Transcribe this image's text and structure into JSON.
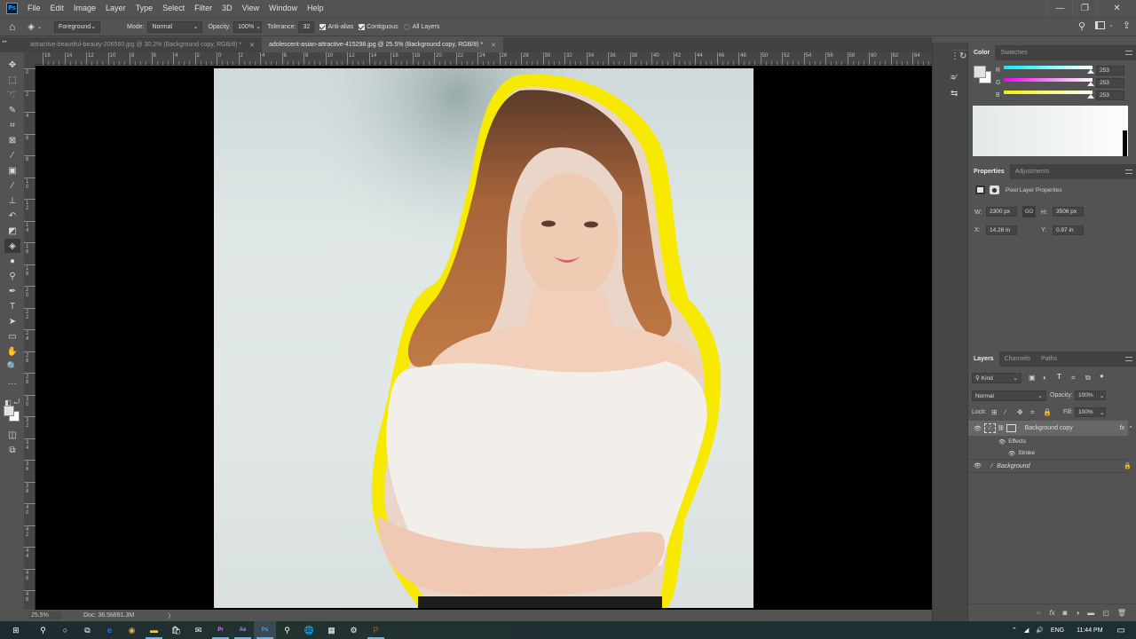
{
  "app": {
    "logo": "Ps",
    "accent": "#31a8ff"
  },
  "menubar": {
    "items": [
      "File",
      "Edit",
      "Image",
      "Layer",
      "Type",
      "Select",
      "Filter",
      "3D",
      "View",
      "Window",
      "Help"
    ]
  },
  "window_controls": {
    "minimize": "—",
    "restore": "❐",
    "close": "✕"
  },
  "options_bar": {
    "fill_source": "Foreground",
    "mode_label": "Mode:",
    "mode_value": "Normal",
    "opacity_label": "Opacity:",
    "opacity_value": "100%",
    "tolerance_label": "Tolerance:",
    "tolerance_value": "32",
    "anti_alias_label": "Anti-alias",
    "anti_alias_checked": true,
    "contiguous_label": "Contiguous",
    "contiguous_checked": true,
    "all_layers_label": "All Layers",
    "all_layers_checked": false
  },
  "doc_tabs": [
    {
      "title": "attractive-beautiful-beauty-206560.jpg @ 30.2% (Background copy, RGB/8) *",
      "active": false
    },
    {
      "title": "adolescent-asian-attractive-415298.jpg @ 25.5% (Background copy, RGB/8) *",
      "active": true
    }
  ],
  "ruler_top": {
    "labels": [
      "16",
      "14",
      "12",
      "10",
      "8",
      "6",
      "4",
      "2",
      "0",
      "2",
      "4",
      "6",
      "8",
      "10",
      "12",
      "14",
      "16",
      "18",
      "20",
      "22",
      "24",
      "26",
      "28",
      "30",
      "32",
      "34",
      "36",
      "38",
      "40",
      "42",
      "44",
      "46",
      "48",
      "50",
      "52",
      "54",
      "56",
      "58",
      "60",
      "62",
      "64"
    ]
  },
  "ruler_left": {
    "labels": [
      "0",
      "2",
      "4",
      "6",
      "8",
      "10",
      "12",
      "14",
      "16",
      "18",
      "20",
      "22",
      "24",
      "26",
      "28",
      "30",
      "32",
      "34",
      "36",
      "38",
      "40",
      "42",
      "44",
      "46",
      "48"
    ]
  },
  "tools": [
    {
      "name": "move-tool",
      "glyph": "✥"
    },
    {
      "name": "marquee-tool",
      "glyph": "⬚"
    },
    {
      "name": "lasso-tool",
      "glyph": "➰"
    },
    {
      "name": "quick-selection-tool",
      "glyph": "✎"
    },
    {
      "name": "crop-tool",
      "glyph": "⌗"
    },
    {
      "name": "frame-tool",
      "glyph": "⊠"
    },
    {
      "name": "eyedropper-tool",
      "glyph": "⁄"
    },
    {
      "name": "healing-brush-tool",
      "glyph": "▣"
    },
    {
      "name": "brush-tool",
      "glyph": "∕"
    },
    {
      "name": "clone-stamp-tool",
      "glyph": "⊥"
    },
    {
      "name": "history-brush-tool",
      "glyph": "↶"
    },
    {
      "name": "eraser-tool",
      "glyph": "◩"
    },
    {
      "name": "paint-bucket-tool",
      "glyph": "◈"
    },
    {
      "name": "blur-tool",
      "glyph": "●"
    },
    {
      "name": "dodge-tool",
      "glyph": "⚲"
    },
    {
      "name": "pen-tool",
      "glyph": "✒"
    },
    {
      "name": "type-tool",
      "glyph": "T"
    },
    {
      "name": "path-selection-tool",
      "glyph": "➤"
    },
    {
      "name": "rectangle-tool",
      "glyph": "▭"
    },
    {
      "name": "hand-tool",
      "glyph": "✋"
    },
    {
      "name": "zoom-tool",
      "glyph": "🔍"
    },
    {
      "name": "more-tools",
      "glyph": "…"
    }
  ],
  "status_bar": {
    "zoom": "25.5%",
    "doc": "Doc: 36.5M/81.3M",
    "arrow": "〉"
  },
  "color_panel": {
    "tabs": [
      "Color",
      "Swatches"
    ],
    "r_label": "R",
    "g_label": "G",
    "b_label": "B",
    "r": "253",
    "g": "253",
    "b": "253",
    "r_fraction": 0.99,
    "g_fraction": 0.99,
    "b_fraction": 0.99
  },
  "properties_panel": {
    "tabs": [
      "Properties",
      "Adjustments"
    ],
    "title": "Pixel Layer Properties",
    "w_label": "W:",
    "w": "2300 px",
    "h_label": "H:",
    "h": "3506 px",
    "link_label": "GO",
    "x_label": "X:",
    "x": "14.28 in",
    "y_label": "Y:",
    "y": "0.97 in"
  },
  "layers_panel": {
    "tabs": [
      "Layers",
      "Channels",
      "Paths"
    ],
    "filter_kind": "Kind",
    "blend_mode": "Normal",
    "opacity_label": "Opacity:",
    "opacity": "100%",
    "lock_label": "Lock:",
    "fill_label": "Fill:",
    "fill": "100%",
    "layers": [
      {
        "name": "Background copy",
        "fx": "fx",
        "selected": true
      },
      {
        "name": "Effects",
        "sub": true
      },
      {
        "name": "Stroke",
        "sub2": true
      },
      {
        "name": "Background",
        "locked": true
      }
    ]
  },
  "photo": {
    "stroke_color": "#ffee00",
    "hair_color": "#b06a3a",
    "shirt_color": "#f1eeeb",
    "skin_color": "#f2cdb8"
  },
  "taskbar": {
    "apps": [
      "Start",
      "Search",
      "Cortana",
      "Task View",
      "Edge",
      "Chrome",
      "File Explorer",
      "Store",
      "Mail",
      "Premiere Pro",
      "After Effects",
      "Photoshop",
      "Search App",
      "Internet",
      "Calculator",
      "Control Panel",
      "PowerPoint"
    ],
    "tray": {
      "language": "ENG",
      "time": "11:44 PM"
    }
  }
}
